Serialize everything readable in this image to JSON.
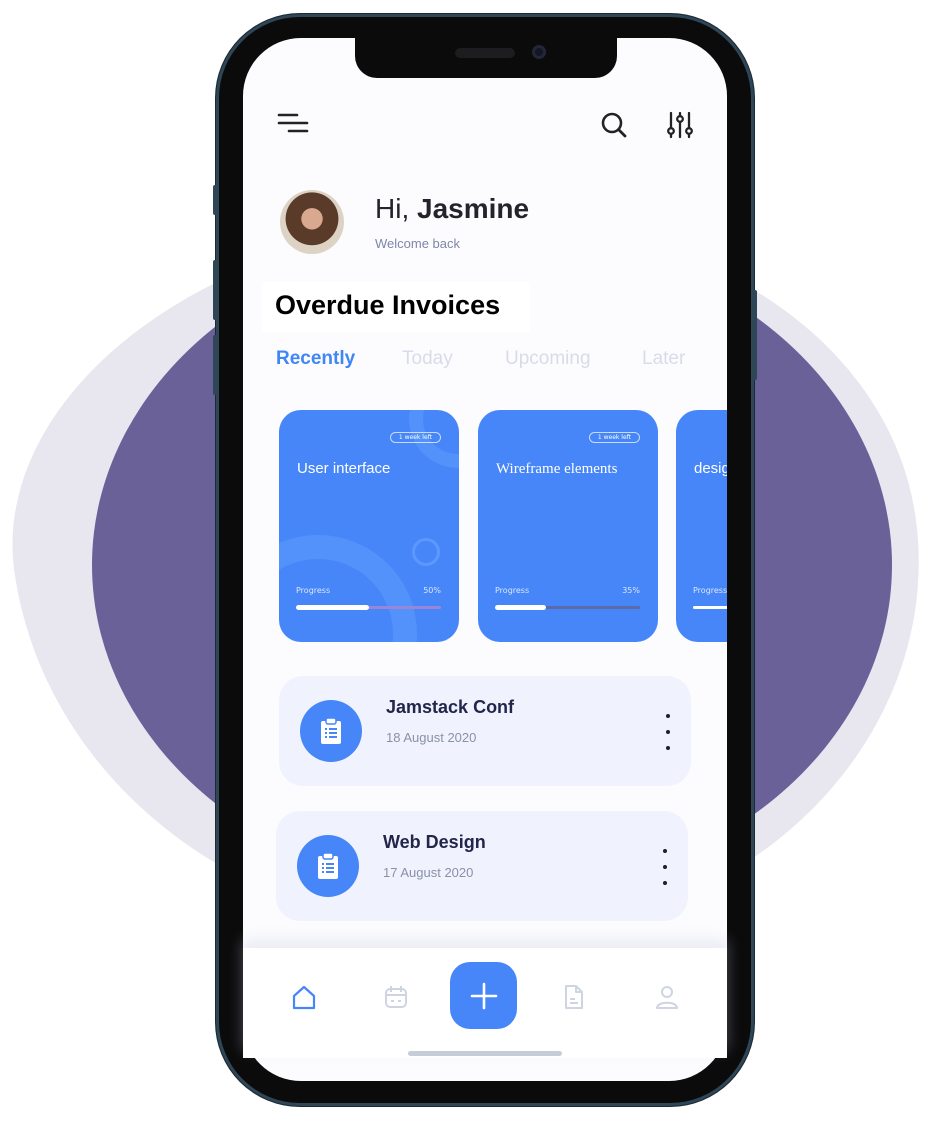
{
  "header": {
    "menu_icon": "hamburger-menu-icon",
    "search_icon": "search-icon",
    "filter_icon": "sliders-icon"
  },
  "profile": {
    "greeting_prefix": "Hi, ",
    "name": "Jasmine",
    "subtitle": "Welcome back"
  },
  "section_title": "Overdue Invoices",
  "tabs": [
    {
      "label": "Recently",
      "active": true
    },
    {
      "label": "Today",
      "active": false
    },
    {
      "label": "Upcoming",
      "active": false
    },
    {
      "label": "Later",
      "active": false
    }
  ],
  "cards": [
    {
      "title": "User interface",
      "badge": "1 week left",
      "progress_label": "Progress",
      "progress_text": "50%",
      "progress": 0.5
    },
    {
      "title": "Wireframe elements",
      "badge": "1 week left",
      "progress_label": "Progress",
      "progress_text": "35%",
      "progress": 0.35
    },
    {
      "title": "design Landing",
      "progress_label": "Progress"
    }
  ],
  "list": [
    {
      "name": "Jamstack Conf",
      "date": "18 August 2020",
      "icon": "clipboard-icon"
    },
    {
      "name": "Web Design",
      "date": "17 August 2020",
      "icon": "clipboard-icon"
    }
  ],
  "bottom_nav": [
    {
      "icon": "home-icon",
      "active": true
    },
    {
      "icon": "calendar-icon",
      "active": false
    },
    {
      "icon": "plus-icon",
      "primary": true
    },
    {
      "icon": "document-icon",
      "active": false
    },
    {
      "icon": "user-icon",
      "active": false
    }
  ],
  "colors": {
    "accent": "#4686f8",
    "background_blob": "#6a6199",
    "text_dark": "#23264a",
    "tab_inactive": "#d8dce8"
  }
}
